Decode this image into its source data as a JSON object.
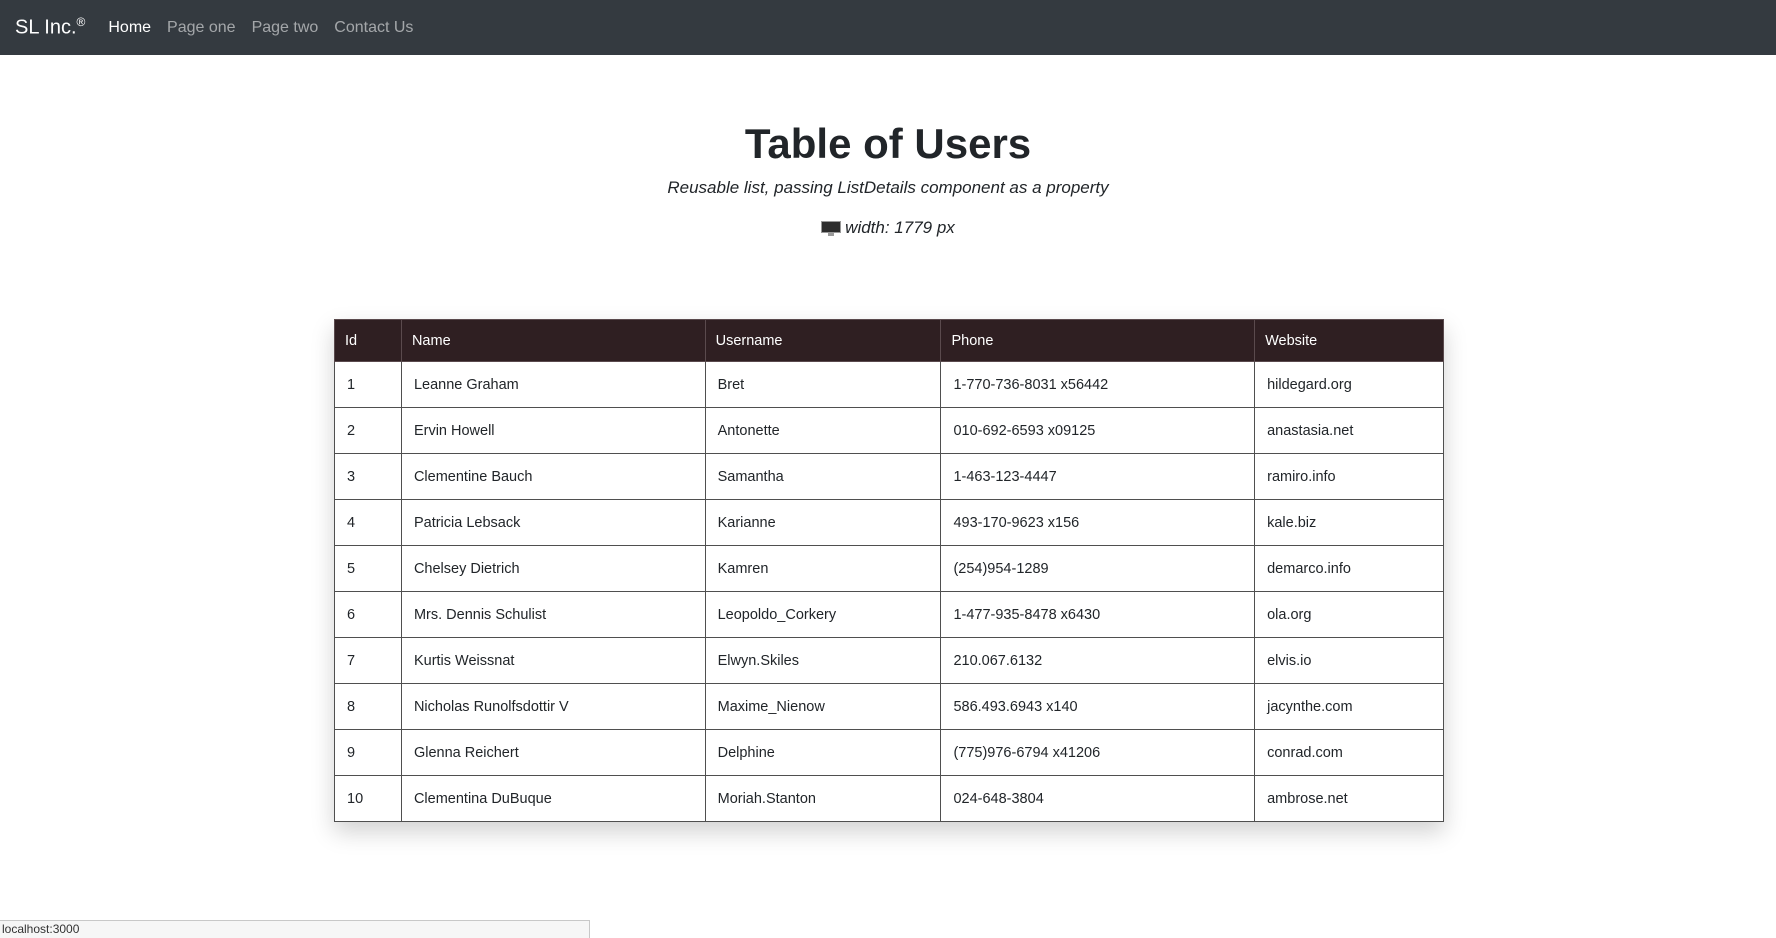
{
  "navbar": {
    "brand": "SL Inc.",
    "brand_mark": "®",
    "links": [
      {
        "label": "Home",
        "active": true
      },
      {
        "label": "Page one",
        "active": false
      },
      {
        "label": "Page two",
        "active": false
      },
      {
        "label": "Contact Us",
        "active": false
      }
    ]
  },
  "header": {
    "title": "Table of Users",
    "subtitle": "Reusable list, passing ListDetails component as a property",
    "width_icon": "monitor-icon",
    "width_text": "width: 1779 px"
  },
  "table": {
    "columns": [
      "Id",
      "Name",
      "Username",
      "Phone",
      "Website"
    ],
    "rows": [
      [
        "1",
        "Leanne Graham",
        "Bret",
        "1-770-736-8031 x56442",
        "hildegard.org"
      ],
      [
        "2",
        "Ervin Howell",
        "Antonette",
        "010-692-6593 x09125",
        "anastasia.net"
      ],
      [
        "3",
        "Clementine Bauch",
        "Samantha",
        "1-463-123-4447",
        "ramiro.info"
      ],
      [
        "4",
        "Patricia Lebsack",
        "Karianne",
        "493-170-9623 x156",
        "kale.biz"
      ],
      [
        "5",
        "Chelsey Dietrich",
        "Kamren",
        "(254)954-1289",
        "demarco.info"
      ],
      [
        "6",
        "Mrs. Dennis Schulist",
        "Leopoldo_Corkery",
        "1-477-935-8478 x6430",
        "ola.org"
      ],
      [
        "7",
        "Kurtis Weissnat",
        "Elwyn.Skiles",
        "210.067.6132",
        "elvis.io"
      ],
      [
        "8",
        "Nicholas Runolfsdottir V",
        "Maxime_Nienow",
        "586.493.6943 x140",
        "jacynthe.com"
      ],
      [
        "9",
        "Glenna Reichert",
        "Delphine",
        "(775)976-6794 x41206",
        "conrad.com"
      ],
      [
        "10",
        "Clementina DuBuque",
        "Moriah.Stanton",
        "024-648-3804",
        "ambrose.net"
      ]
    ]
  },
  "status_bar": {
    "url": "localhost:3000"
  },
  "colors": {
    "navbar_bg": "#343a40",
    "table_header_bg": "#2f1f22"
  }
}
